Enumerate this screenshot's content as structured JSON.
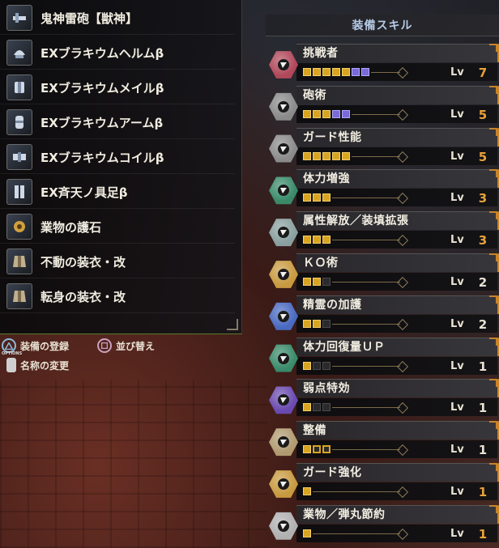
{
  "equipment": [
    {
      "name": "鬼神雷砲【獣神】",
      "icon": "weapon-icon",
      "color": "#8fa0b8"
    },
    {
      "name": "EXブラキウムヘルムβ",
      "icon": "helm-icon",
      "color": "#9fb0c8"
    },
    {
      "name": "EXブラキウムメイルβ",
      "icon": "chest-icon",
      "color": "#9fb0c8"
    },
    {
      "name": "EXブラキウムアームβ",
      "icon": "arm-icon",
      "color": "#9fb0c8"
    },
    {
      "name": "EXブラキウムコイルβ",
      "icon": "waist-icon",
      "color": "#9fb0c8"
    },
    {
      "name": "EX斉天ノ具足β",
      "icon": "leg-icon",
      "color": "#9fb0c8"
    },
    {
      "name": "業物の護石",
      "icon": "charm-icon",
      "color": "#d0a040"
    },
    {
      "name": "不動の装衣・改",
      "icon": "mantle-icon",
      "color": "#c0b090"
    },
    {
      "name": "転身の装衣・改",
      "icon": "mantle-icon",
      "color": "#c0b090"
    }
  ],
  "controls": {
    "register": "装備の登録",
    "sort": "並び替え",
    "rename": "名称の変更",
    "options_label": "OPTIONS"
  },
  "skills_header": "装備スキル",
  "lv_label": "Lv",
  "skills": [
    {
      "name": "挑戦者",
      "level": "7",
      "pips": [
        "gold",
        "gold",
        "gold",
        "gold",
        "gold",
        "purple",
        "purple"
      ],
      "max": 7,
      "color": "#b0485a",
      "level_color": "#e8a23a"
    },
    {
      "name": "砲術",
      "level": "5",
      "pips": [
        "gold",
        "gold",
        "gold",
        "purple",
        "purple"
      ],
      "max": 5,
      "color": "#8a8a8a",
      "level_color": "#e8a23a"
    },
    {
      "name": "ガード性能",
      "level": "5",
      "pips": [
        "gold",
        "gold",
        "gold",
        "gold",
        "gold"
      ],
      "max": 5,
      "color": "#8a8a8a",
      "level_color": "#e8a23a"
    },
    {
      "name": "体力増強",
      "level": "3",
      "pips": [
        "gold",
        "gold",
        "gold"
      ],
      "max": 3,
      "color": "#3a8a6a",
      "level_color": "#e8a23a"
    },
    {
      "name": "属性解放／装填拡張",
      "level": "3",
      "pips": [
        "gold",
        "gold",
        "gold"
      ],
      "max": 3,
      "color": "#8aa0a0",
      "level_color": "#e8a23a"
    },
    {
      "name": "ＫＯ術",
      "level": "2",
      "pips": [
        "gold",
        "gold",
        "empty"
      ],
      "max": 3,
      "color": "#c89a40",
      "level_color": "#e8e2d4"
    },
    {
      "name": "精霊の加護",
      "level": "2",
      "pips": [
        "gold",
        "gold",
        "empty"
      ],
      "max": 3,
      "color": "#4a6ac0",
      "level_color": "#e8e2d4"
    },
    {
      "name": "体力回復量ＵＰ",
      "level": "1",
      "pips": [
        "gold",
        "empty",
        "empty"
      ],
      "max": 3,
      "color": "#3a8a6a",
      "level_color": "#e8e2d4"
    },
    {
      "name": "弱点特効",
      "level": "1",
      "pips": [
        "gold",
        "empty",
        "empty"
      ],
      "max": 3,
      "color": "#6a4ab0",
      "level_color": "#e8e2d4"
    },
    {
      "name": "整備",
      "level": "1",
      "pips": [
        "gold",
        "gold-ring",
        "gold-ring"
      ],
      "max": 3,
      "color": "#b09a70",
      "level_color": "#e8e2d4"
    },
    {
      "name": "ガード強化",
      "level": "1",
      "pips": [
        "gold"
      ],
      "max": 1,
      "color": "#c89a40",
      "level_color": "#e8a23a"
    },
    {
      "name": "業物／弾丸節約",
      "level": "1",
      "pips": [
        "gold"
      ],
      "max": 1,
      "color": "#b0b0b0",
      "level_color": "#e8a23a"
    }
  ]
}
